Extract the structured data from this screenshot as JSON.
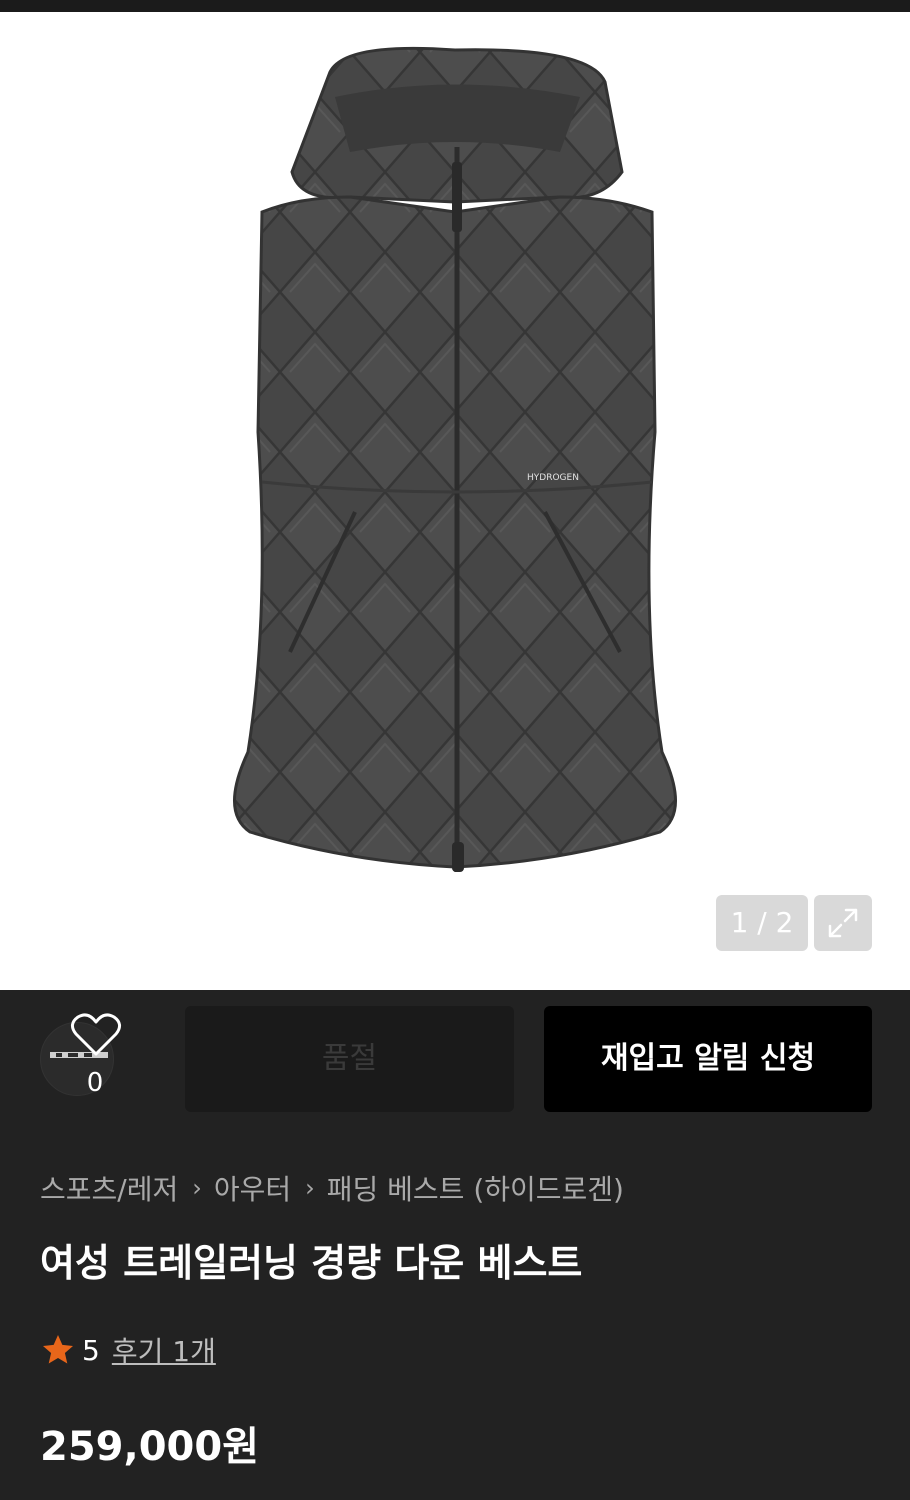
{
  "gallery": {
    "counter": "1 / 2",
    "brand_print": "HYDROGEN"
  },
  "wishlist": {
    "count": "0"
  },
  "actions": {
    "soldout_label": "품절",
    "restock_label": "재입고 알림 신청"
  },
  "breadcrumb": {
    "items": [
      "스포츠/레저",
      "아우터",
      "패딩 베스트 (하이드로겐)"
    ]
  },
  "product": {
    "title": "여성 트레일러닝 경량 다운 베스트",
    "rating": "5",
    "reviews_label": "후기 1개",
    "price": "259,000원"
  },
  "colors": {
    "background": "#222222",
    "accent_star": "#e8661a",
    "vest": "#454545"
  },
  "icons": {
    "wishlist": "heart-icon",
    "expand": "expand-icon",
    "rating": "star-icon",
    "separator": "chevron-right-icon"
  }
}
